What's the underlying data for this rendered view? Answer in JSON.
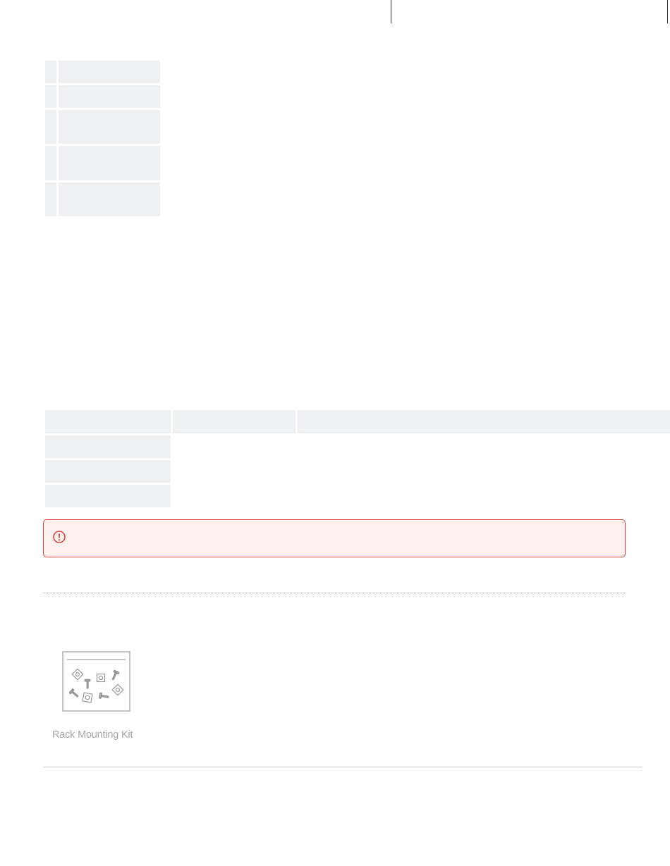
{
  "accessories": {
    "items": [
      {
        "caption": "Rack Mounting Kit",
        "icon": "rack-mounting-kit-icon"
      }
    ]
  },
  "alert": {
    "icon": "exclamation-circle-icon",
    "accent_color": "#d9443b",
    "background_color": "#fdf1f0"
  },
  "colors": {
    "table_cell_fill": "#eef0f1"
  }
}
